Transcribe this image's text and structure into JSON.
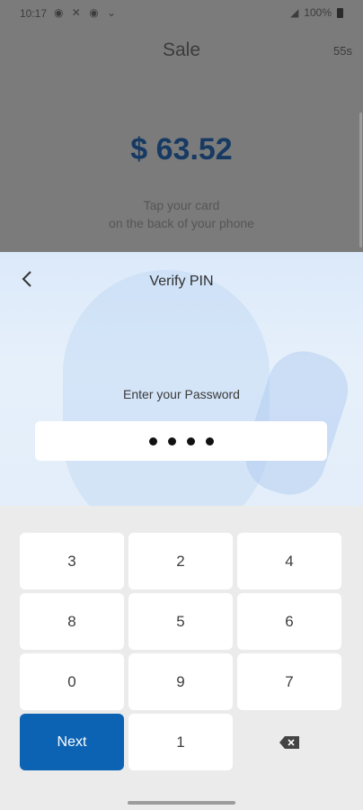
{
  "status_bar": {
    "time": "10:17",
    "left_icons": [
      "notification-icon",
      "x-icon",
      "notification-icon",
      "chevron-icon"
    ],
    "battery": "100%"
  },
  "sale": {
    "title": "Sale",
    "timer": "55s",
    "amount": "$ 63.52",
    "hint_line1": "Tap your card",
    "hint_line2": "on the back of your phone"
  },
  "pin_sheet": {
    "title": "Verify PIN",
    "label": "Enter your Password",
    "masked_digits": 4
  },
  "keypad": {
    "keys": [
      "3",
      "2",
      "4",
      "8",
      "5",
      "6",
      "0",
      "9",
      "7",
      "1"
    ],
    "next_label": "Next",
    "accent_color": "#0d63b3"
  }
}
